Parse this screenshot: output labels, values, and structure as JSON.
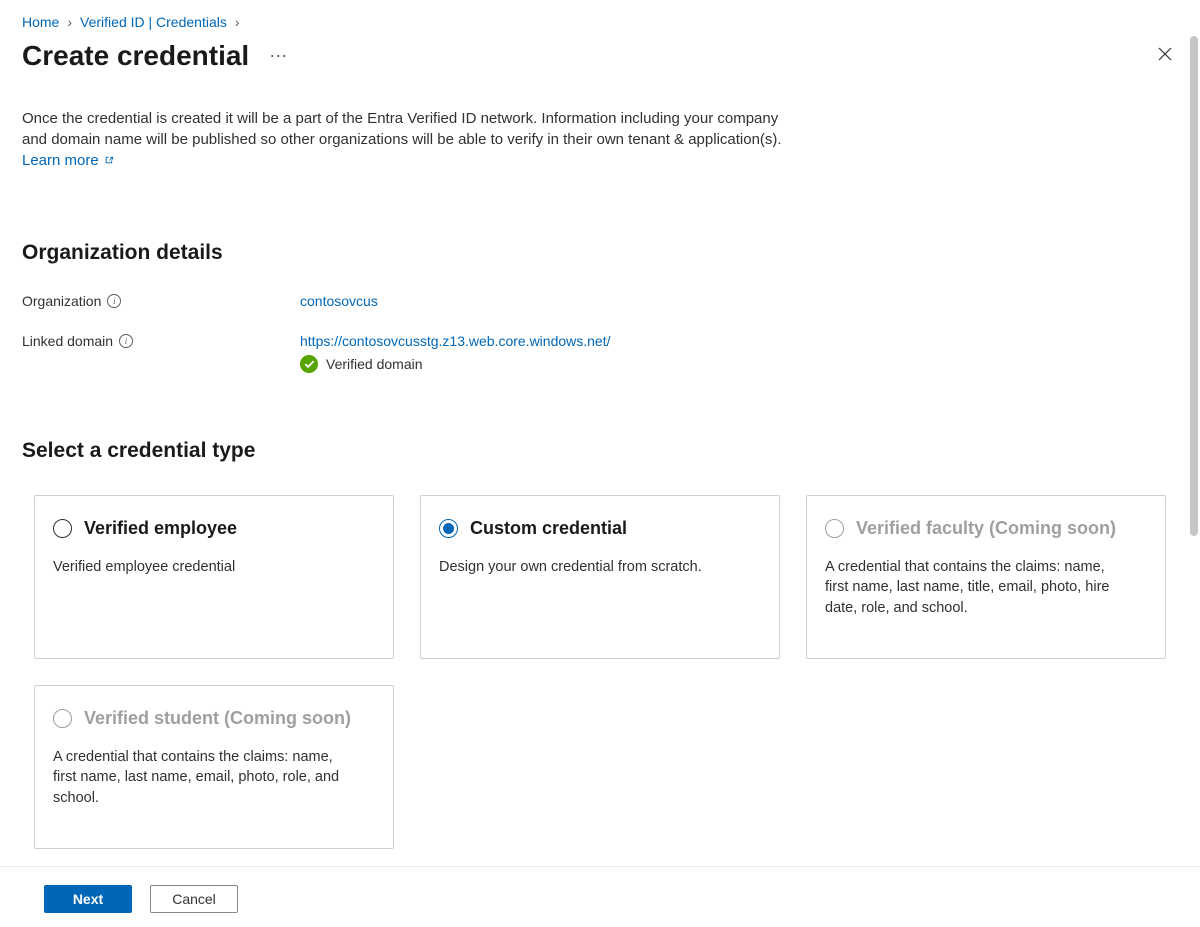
{
  "breadcrumb": {
    "home": "Home",
    "verified_id": "Verified ID | Credentials"
  },
  "title": "Create credential",
  "intro_text": "Once the credential is created it will be a part of the Entra Verified ID network. Information including your company and domain name will be published so other organizations will be able to verify in their own tenant & application(s).",
  "learn_more": "Learn more",
  "sections": {
    "org_details_heading": "Organization details",
    "select_type_heading": "Select a credential type"
  },
  "org": {
    "org_label": "Organization",
    "org_value": "contosovcus",
    "domain_label": "Linked domain",
    "domain_value": "https://contosovcusstg.z13.web.core.windows.net/",
    "verified_text": "Verified domain"
  },
  "cards": {
    "employee": {
      "title": "Verified employee",
      "desc": "Verified employee credential"
    },
    "custom": {
      "title": "Custom credential",
      "desc": "Design your own credential from scratch."
    },
    "faculty": {
      "title": "Verified faculty (Coming soon)",
      "desc": "A credential that contains the claims: name, first name, last name, title, email, photo, hire date, role, and school."
    },
    "student": {
      "title": "Verified student (Coming soon)",
      "desc": "A credential that contains the claims: name, first name, last name, email, photo, role, and school."
    }
  },
  "buttons": {
    "next": "Next",
    "cancel": "Cancel"
  }
}
